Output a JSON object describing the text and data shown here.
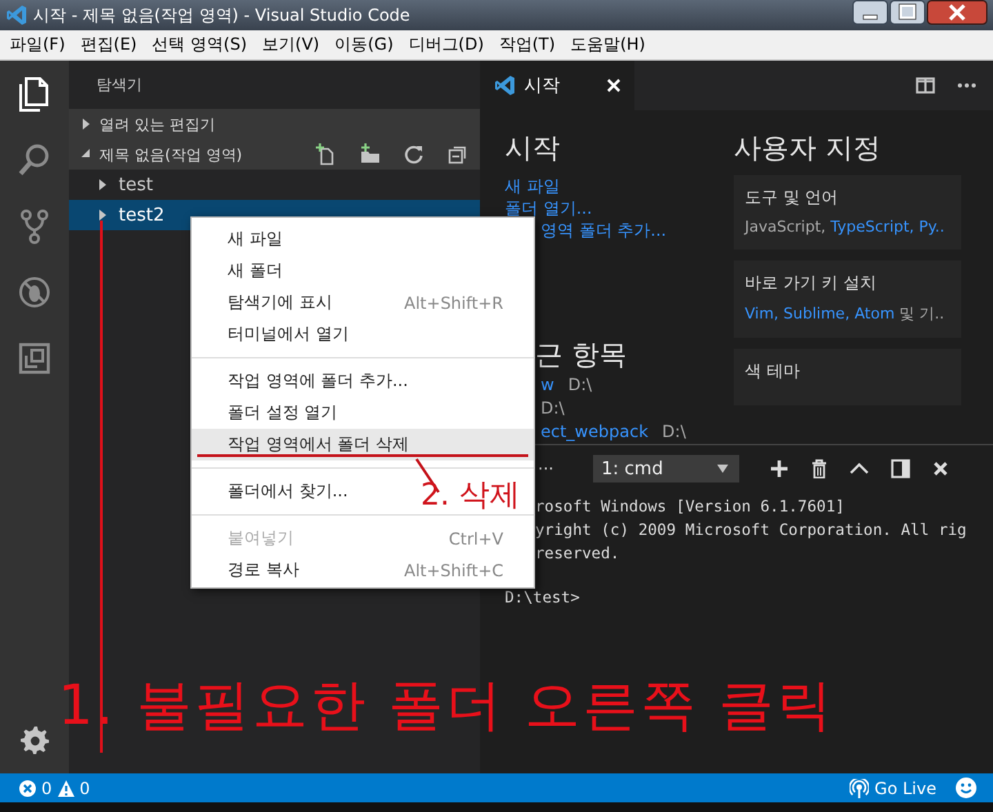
{
  "window": {
    "title": "시작 - 제목 없음(작업 영역) - Visual Studio Code"
  },
  "menu_bar": [
    "파일(F)",
    "편집(E)",
    "선택 영역(S)",
    "보기(V)",
    "이동(G)",
    "디버그(D)",
    "작업(T)",
    "도움말(H)"
  ],
  "activity_bar": [
    {
      "kind": "files",
      "selected": true
    },
    {
      "kind": "search",
      "selected": false
    },
    {
      "kind": "scm",
      "selected": false
    },
    {
      "kind": "debug",
      "selected": false
    },
    {
      "kind": "extensions",
      "selected": false
    }
  ],
  "sidebar": {
    "title": "탐색기",
    "sections": [
      {
        "label": "열려 있는 편집기",
        "expanded": false
      },
      {
        "label": "제목 없음(작업 영역)",
        "expanded": true
      }
    ],
    "tree": [
      {
        "label": "test",
        "selected": false
      },
      {
        "label": "test2",
        "selected": true
      }
    ]
  },
  "editor": {
    "tabs": [
      {
        "label": "시작",
        "selected": true
      }
    ],
    "welcome": {
      "start_heading": "시작",
      "start_links": [
        {
          "text": "새 파일",
          "cut": false
        },
        {
          "text": "폴더 열기...",
          "cut": false
        },
        {
          "text": "영역 폴더 추가...",
          "cut": true
        }
      ],
      "recent_heading": "근 항목",
      "recent": [
        {
          "name": "w",
          "path": "D:\\"
        },
        {
          "path": "D:\\"
        },
        {
          "name": "ect_webpack",
          "path": "D:\\"
        }
      ],
      "customize_heading": "사용자 지정",
      "cards": [
        {
          "title": "도구 및 언어",
          "parts": [
            {
              "text": "JavaScript, ",
              "link": false
            },
            {
              "text": "TypeScript, Py..",
              "link": true
            }
          ]
        },
        {
          "title": "바로 가기 키 설치",
          "parts": [
            {
              "text": "Vim, Sublime, Atom",
              "link": true
            },
            {
              "text": " 및 기..",
              "link": false
            }
          ]
        },
        {
          "title": "색 테마"
        }
      ]
    }
  },
  "terminal": {
    "more": "···",
    "selector": "1: cmd",
    "lines": [
      {
        "text": "rosoft Windows [Version 6.1.7601]",
        "cut": true
      },
      {
        "text": "yright (c) 2009 Microsoft Corporation. All rig",
        "cut": true
      },
      {
        "text": "reserved.",
        "cut": true
      },
      {
        "text": "D:\\test>",
        "cut": false,
        "kind": "prompt"
      }
    ]
  },
  "context_menu": [
    {
      "kind": "item",
      "label": "새 파일",
      "highlighted": false,
      "disabled": false
    },
    {
      "kind": "item",
      "label": "새 폴더",
      "highlighted": false,
      "disabled": false
    },
    {
      "kind": "item",
      "label": "탐색기에 표시",
      "shortcut": "Alt+Shift+R",
      "highlighted": false,
      "disabled": false
    },
    {
      "kind": "item",
      "label": "터미널에서 열기",
      "highlighted": false,
      "disabled": false
    },
    {
      "kind": "separator"
    },
    {
      "kind": "item",
      "label": "작업 영역에 폴더 추가...",
      "highlighted": false,
      "disabled": false
    },
    {
      "kind": "item",
      "label": "폴더 설정 열기",
      "highlighted": false,
      "disabled": false
    },
    {
      "kind": "item",
      "label": "작업 영역에서 폴더 삭제",
      "highlighted": true,
      "disabled": false
    },
    {
      "kind": "separator"
    },
    {
      "kind": "item",
      "label": "폴더에서 찾기...",
      "highlighted": false,
      "disabled": false
    },
    {
      "kind": "separator"
    },
    {
      "kind": "item",
      "label": "붙여넣기",
      "shortcut": "Ctrl+V",
      "highlighted": false,
      "disabled": true
    },
    {
      "kind": "item",
      "label": "경로 복사",
      "shortcut": "Alt+Shift+C",
      "highlighted": false,
      "disabled": false
    }
  ],
  "annotations": [
    {
      "kind": "step",
      "text": "2. 삭제"
    },
    {
      "kind": "caption",
      "text": "1. 불필요한 폴더 오른쪽 클릭"
    }
  ],
  "status_bar": {
    "errors": "0",
    "warnings": "0",
    "live": "Go Live"
  }
}
